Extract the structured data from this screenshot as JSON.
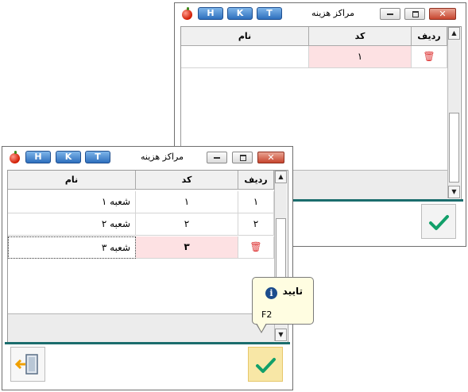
{
  "back_window": {
    "title": "مراکز هزینه",
    "buttons": [
      "H",
      "K",
      "T"
    ],
    "close_label": "✕",
    "columns": {
      "row": "ردیف",
      "code": "کد",
      "name": "نام"
    },
    "rows": [
      {
        "row": "",
        "code": "۱",
        "name": ""
      }
    ]
  },
  "front_window": {
    "title": "مراکز هزینه",
    "buttons": [
      "H",
      "K",
      "T"
    ],
    "close_label": "✕",
    "columns": {
      "row": "ردیف",
      "code": "کد",
      "name": "نام"
    },
    "rows": [
      {
        "row": "۱",
        "code": "۱",
        "name": "شعبه ۱"
      },
      {
        "row": "۲",
        "code": "۲",
        "name": "شعبه ۲"
      },
      {
        "row": "",
        "code": "۳",
        "name": "شعبه ۳"
      }
    ]
  },
  "tooltip": {
    "title": "تایید",
    "shortcut": "F2",
    "icon": "info-icon"
  },
  "icons": {
    "delete": "trash-icon",
    "ok": "check-icon",
    "exit": "exit-door-icon"
  },
  "colors": {
    "accent": "#1b6d6d",
    "check": "#12a06a",
    "pink_cell": "#fde1e3",
    "highlight": "#f8e7a6"
  }
}
